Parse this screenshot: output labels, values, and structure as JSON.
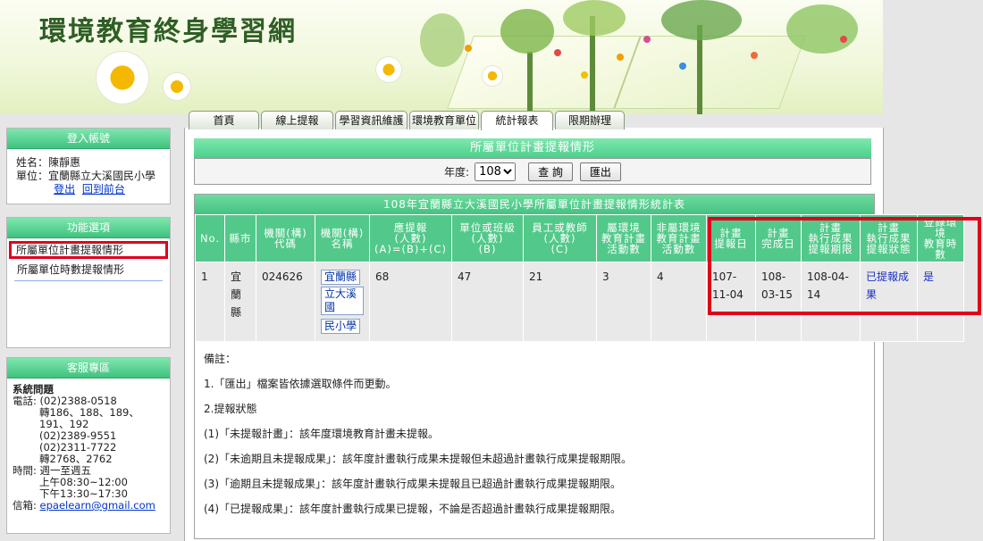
{
  "site": {
    "title": "環境教育終身學習網"
  },
  "tabs": [
    "首頁",
    "線上提報",
    "學習資訊維護",
    "環境教育單位",
    "統計報表",
    "限期辦理"
  ],
  "login": {
    "header": "登入帳號",
    "name_label": "姓名：",
    "name": "陳靜惠",
    "unit_label": "單位：",
    "unit": "宜蘭縣立大溪國民小學",
    "logout": "登出",
    "back": "回到前台"
  },
  "functions": {
    "header": "功能選項",
    "items": [
      "所屬單位計畫提報情形",
      "所屬單位時數提報情形"
    ]
  },
  "service": {
    "header": "客服專區",
    "system": "系統問題",
    "phone_label": "電話:",
    "phone1": "(02)2388-0518",
    "ext1": "轉186、188、189、191、192",
    "phone2": "(02)2389-9551",
    "phone3": "(02)2311-7722",
    "ext2": "轉2768、2762",
    "time_label": "時間:",
    "days": "週一至週五",
    "am": "上午08:30~12:00",
    "pm": "下午13:30~17:30",
    "mail_label": "信箱:",
    "mail": "epaelearn@gmail.com"
  },
  "panel": {
    "title": "所屬單位計畫提報情形",
    "year_label": "年度:",
    "year": "108",
    "query": "查 詢",
    "export": "匯出"
  },
  "report": {
    "title": "108年宜蘭縣立大溪國民小學所屬單位計畫提報情形統計表",
    "headers": [
      "No.",
      "縣市",
      "機關(構)\n代碼",
      "機關(構)\n名稱",
      "應提報\n(人數)\n(A)=(B)+(C)",
      "單位或班級\n(人數)\n(B)",
      "員工或教師\n(人數)\n(C)",
      "屬環境\n教育計畫\n活動數",
      "非屬環境\n教育計畫\n活動數",
      "計畫\n提報日",
      "計畫\n完成日",
      "計畫\n執行成果\n提報期限",
      "計畫\n執行成果\n提報狀態",
      "登錄環境\n教育時數"
    ],
    "row": {
      "no": "1",
      "county": "宜蘭縣",
      "code": "024626",
      "org_name": [
        "宜蘭縣",
        "立大溪國",
        "民小學"
      ],
      "should_report": "68",
      "unit_count": "47",
      "staff_count": "21",
      "env_activities": "3",
      "non_env_activities": "4",
      "report_date": "107-11-04",
      "done_date": "108-03-15",
      "deadline": "108-04-14",
      "status": "已提報成果",
      "hours": "是"
    }
  },
  "notes": [
    "備註：",
    "1.「匯出」檔案皆依據選取條件而更動。",
    "2.提報狀態",
    "(1)「未提報計畫」：該年度環境教育計畫未提報。",
    "(2)「未逾期且未提報成果」：該年度計畫執行成果未提報但未超過計畫執行成果提報期限。",
    "(3)「逾期且未提報成果」：該年度計畫執行成果未提報且已超過計畫執行成果提報期限。",
    "(4)「已提報成果」：該年度計畫執行成果已提報，不論是否超過計畫執行成果提報期限。"
  ],
  "colors": {
    "green": "#52c98a",
    "highlight": "#e0001b",
    "link": "#0033cc"
  }
}
